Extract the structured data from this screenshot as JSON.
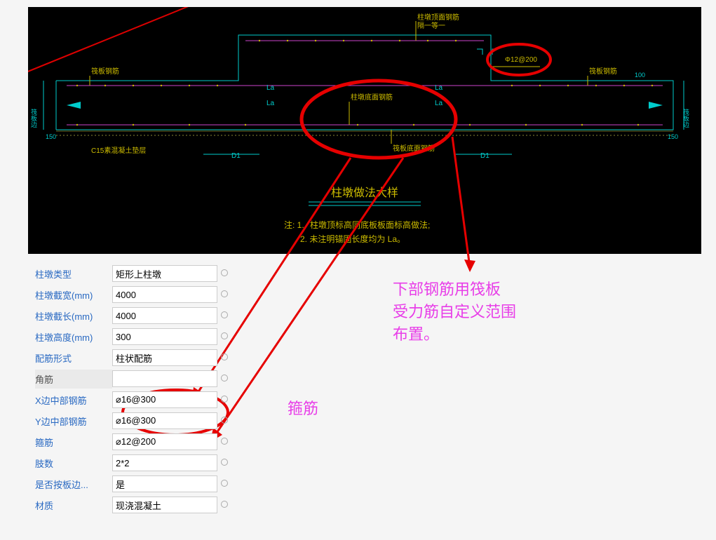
{
  "cad": {
    "title": "柱墩做法大样",
    "note_prefix": "注: 1.",
    "note1": "柱墩顶标高同底板板面标高做法;",
    "note2": "2. 未注明锚固长度均为 La。",
    "labels": {
      "top_left": "柱墩顶面钢筋",
      "top_left2": "隔一等一",
      "top_rebar": "Φ12@200",
      "slab_left": "筏板钢筋",
      "slab_right": "筏板钢筋",
      "mid": "柱墩底面钢筋",
      "bottom": "筏板底面钢筋",
      "c15": "C15素混凝土垫层",
      "la": "La",
      "d1": "D1",
      "edge_left": "筏板边",
      "edge_right": "筏板边",
      "dim100": "100",
      "dim150": "150"
    }
  },
  "annotations": {
    "gu": "箍筋",
    "bottom_note_l1": "下部钢筋用筏板",
    "bottom_note_l2": "受力筋自定义范围",
    "bottom_note_l3": "布置。"
  },
  "form": {
    "rows": [
      {
        "label": "柱墩类型",
        "value": "矩形上柱墩"
      },
      {
        "label": "柱墩截宽(mm)",
        "value": "4000"
      },
      {
        "label": "柱墩截长(mm)",
        "value": "4000"
      },
      {
        "label": "柱墩高度(mm)",
        "value": "300"
      },
      {
        "label": "配筋形式",
        "value": "柱状配筋"
      },
      {
        "label": "角筋",
        "value": "",
        "gray": true
      },
      {
        "label": "X边中部钢筋",
        "value": "⌀16@300"
      },
      {
        "label": "Y边中部钢筋",
        "value": "⌀16@300"
      },
      {
        "label": "箍筋",
        "value": "⌀12@200"
      },
      {
        "label": "肢数",
        "value": "2*2"
      },
      {
        "label": "是否按板边...",
        "value": "是"
      },
      {
        "label": "材质",
        "value": "现浇混凝土"
      }
    ]
  }
}
